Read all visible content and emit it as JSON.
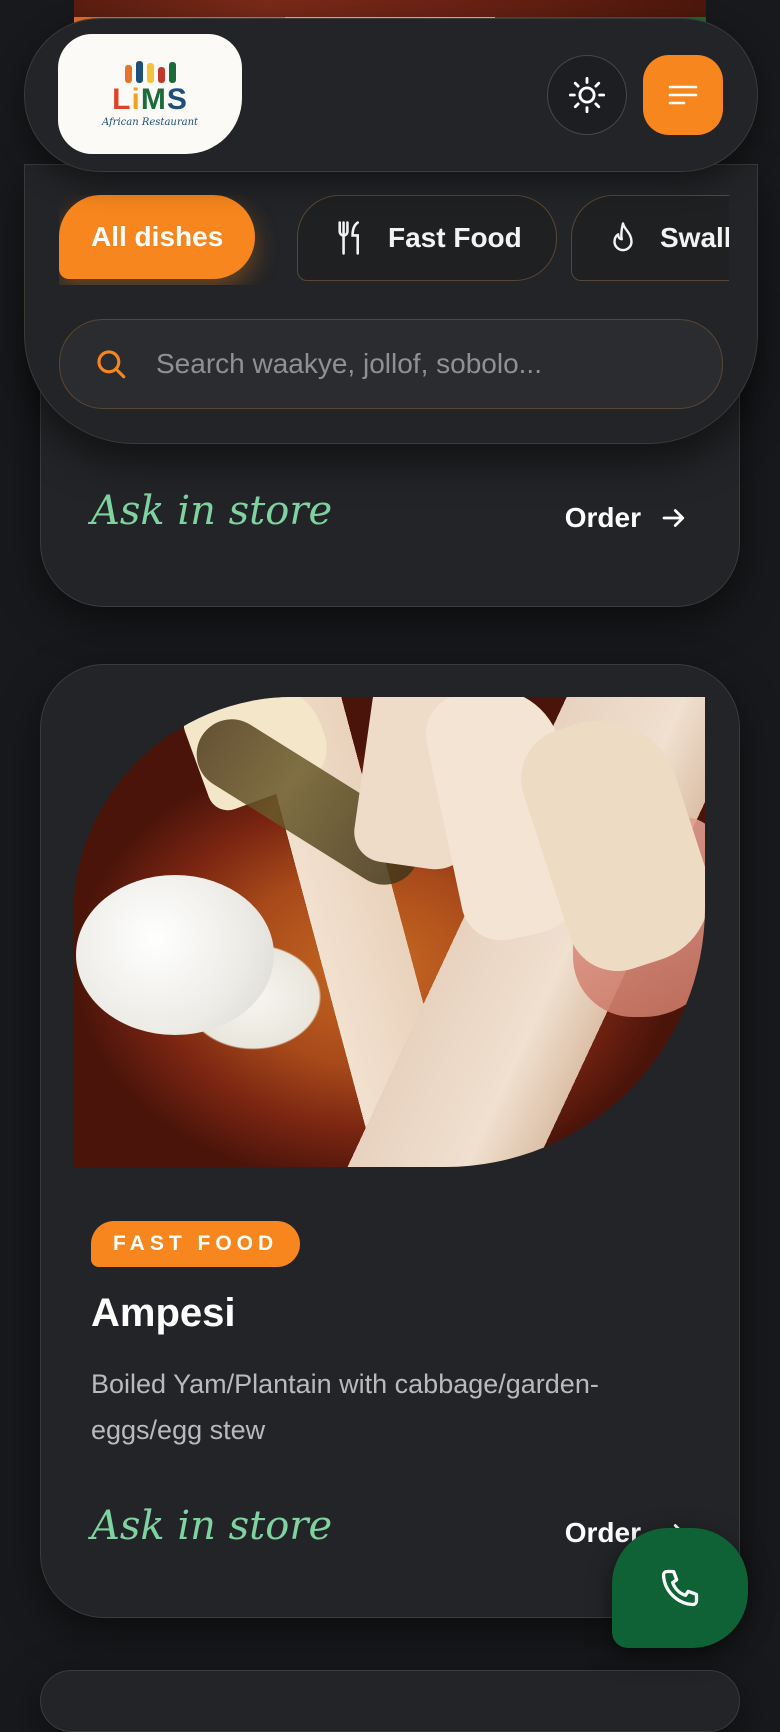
{
  "brand": {
    "logo_text": "LiMS",
    "logo_tagline": "African Restaurant",
    "stripe_colors": [
      "#e8742a",
      "#f5c33b",
      "#1c6b3b"
    ]
  },
  "header": {
    "theme_toggle_icon": "sun-icon",
    "menu_icon": "menu-icon"
  },
  "filters": {
    "chips": [
      {
        "label": "All dishes",
        "icon": null,
        "active": true
      },
      {
        "label": "Fast Food",
        "icon": "fork-knife-icon",
        "active": false
      },
      {
        "label": "Swallow",
        "icon": "flame-icon",
        "active": false
      }
    ]
  },
  "search": {
    "placeholder": "Search waakye, jollof, sobolo...",
    "value": ""
  },
  "previous_card": {
    "price_text": "Ask in store",
    "order_label": "Order"
  },
  "dish": {
    "category": "FAST FOOD",
    "name": "Ampesi",
    "description": "Boiled Yam/Plantain with cabbage/garden-eggs/egg stew",
    "price_text": "Ask in store",
    "order_label": "Order"
  },
  "fab": {
    "icon": "phone-icon"
  },
  "colors": {
    "accent": "#f7861e",
    "price_green": "#7fd3a1",
    "call_green": "#0f6236",
    "background": "#18191c",
    "card": "#232427"
  }
}
